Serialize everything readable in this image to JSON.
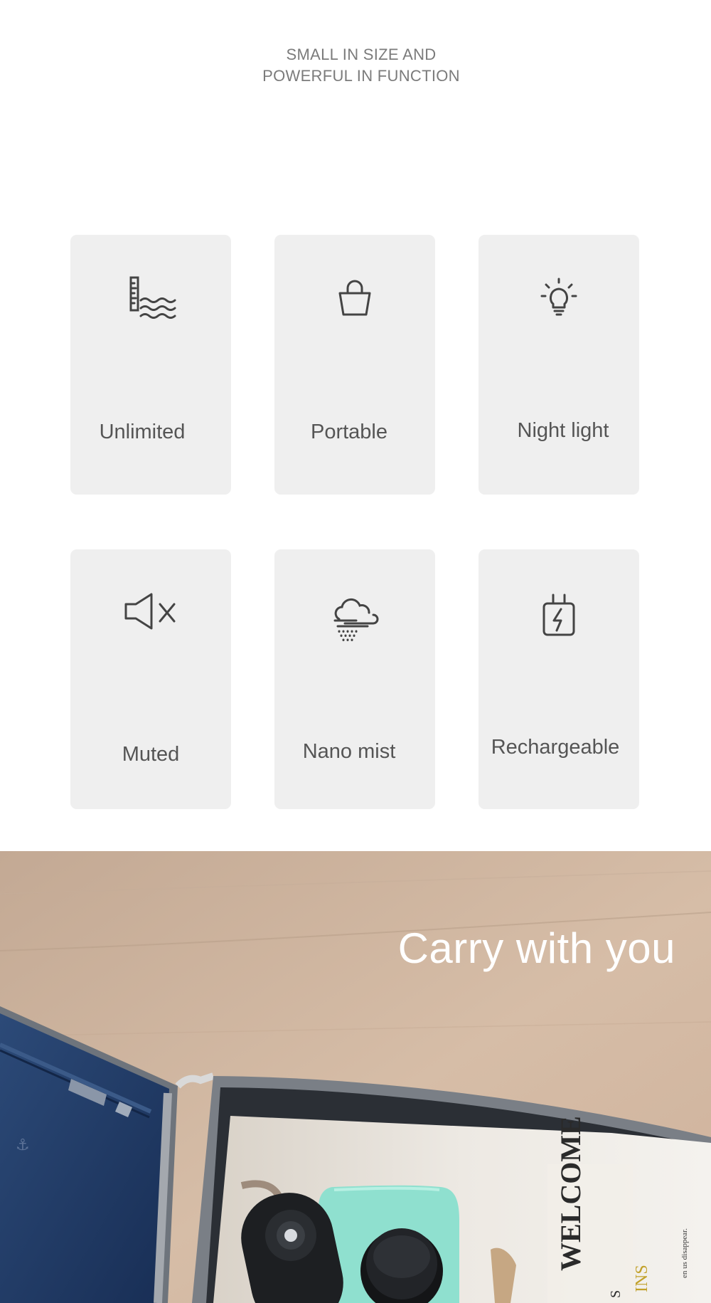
{
  "header": {
    "line1": "SMALL IN SIZE AND",
    "line2": "POWERFUL IN FUNCTION"
  },
  "features": [
    {
      "label": "Unlimited",
      "icon": "water-level-icon"
    },
    {
      "label": "Portable",
      "icon": "bag-icon"
    },
    {
      "label": "Night light",
      "icon": "light-bulb-icon"
    },
    {
      "label": "Muted",
      "icon": "speaker-muted-icon"
    },
    {
      "label": "Nano mist",
      "icon": "mist-cloud-icon"
    },
    {
      "label": "Rechargeable",
      "icon": "charging-plug-icon"
    }
  ],
  "banner": {
    "caption": "Carry with you",
    "magazine_text": "WELCOME",
    "magazine_sub": "INS",
    "magazine_small": "S",
    "magazine_tiny": "en us disappear."
  },
  "colors": {
    "card_bg": "#efefef",
    "label_text": "#555555",
    "header_text": "#7b7b7b",
    "icon_stroke": "#444444",
    "accent_mint": "#8fe0cf"
  }
}
